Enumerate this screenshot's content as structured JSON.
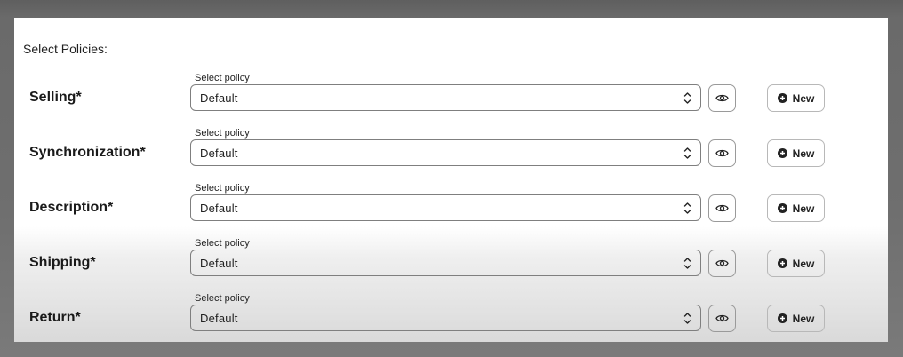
{
  "section": {
    "heading": "Select Policies:"
  },
  "policies": [
    {
      "label": "Selling*",
      "field_label": "Select policy",
      "value": "Default",
      "new_label": "New"
    },
    {
      "label": "Synchronization*",
      "field_label": "Select policy",
      "value": "Default",
      "new_label": "New"
    },
    {
      "label": "Description*",
      "field_label": "Select policy",
      "value": "Default",
      "new_label": "New"
    },
    {
      "label": "Shipping*",
      "field_label": "Select policy",
      "value": "Default",
      "new_label": "New"
    },
    {
      "label": "Return*",
      "field_label": "Select policy",
      "value": "Default",
      "new_label": "New"
    }
  ],
  "icons": {
    "view": "eye-icon",
    "add": "plus-circle-icon",
    "select": "chevron-updown-icon"
  }
}
